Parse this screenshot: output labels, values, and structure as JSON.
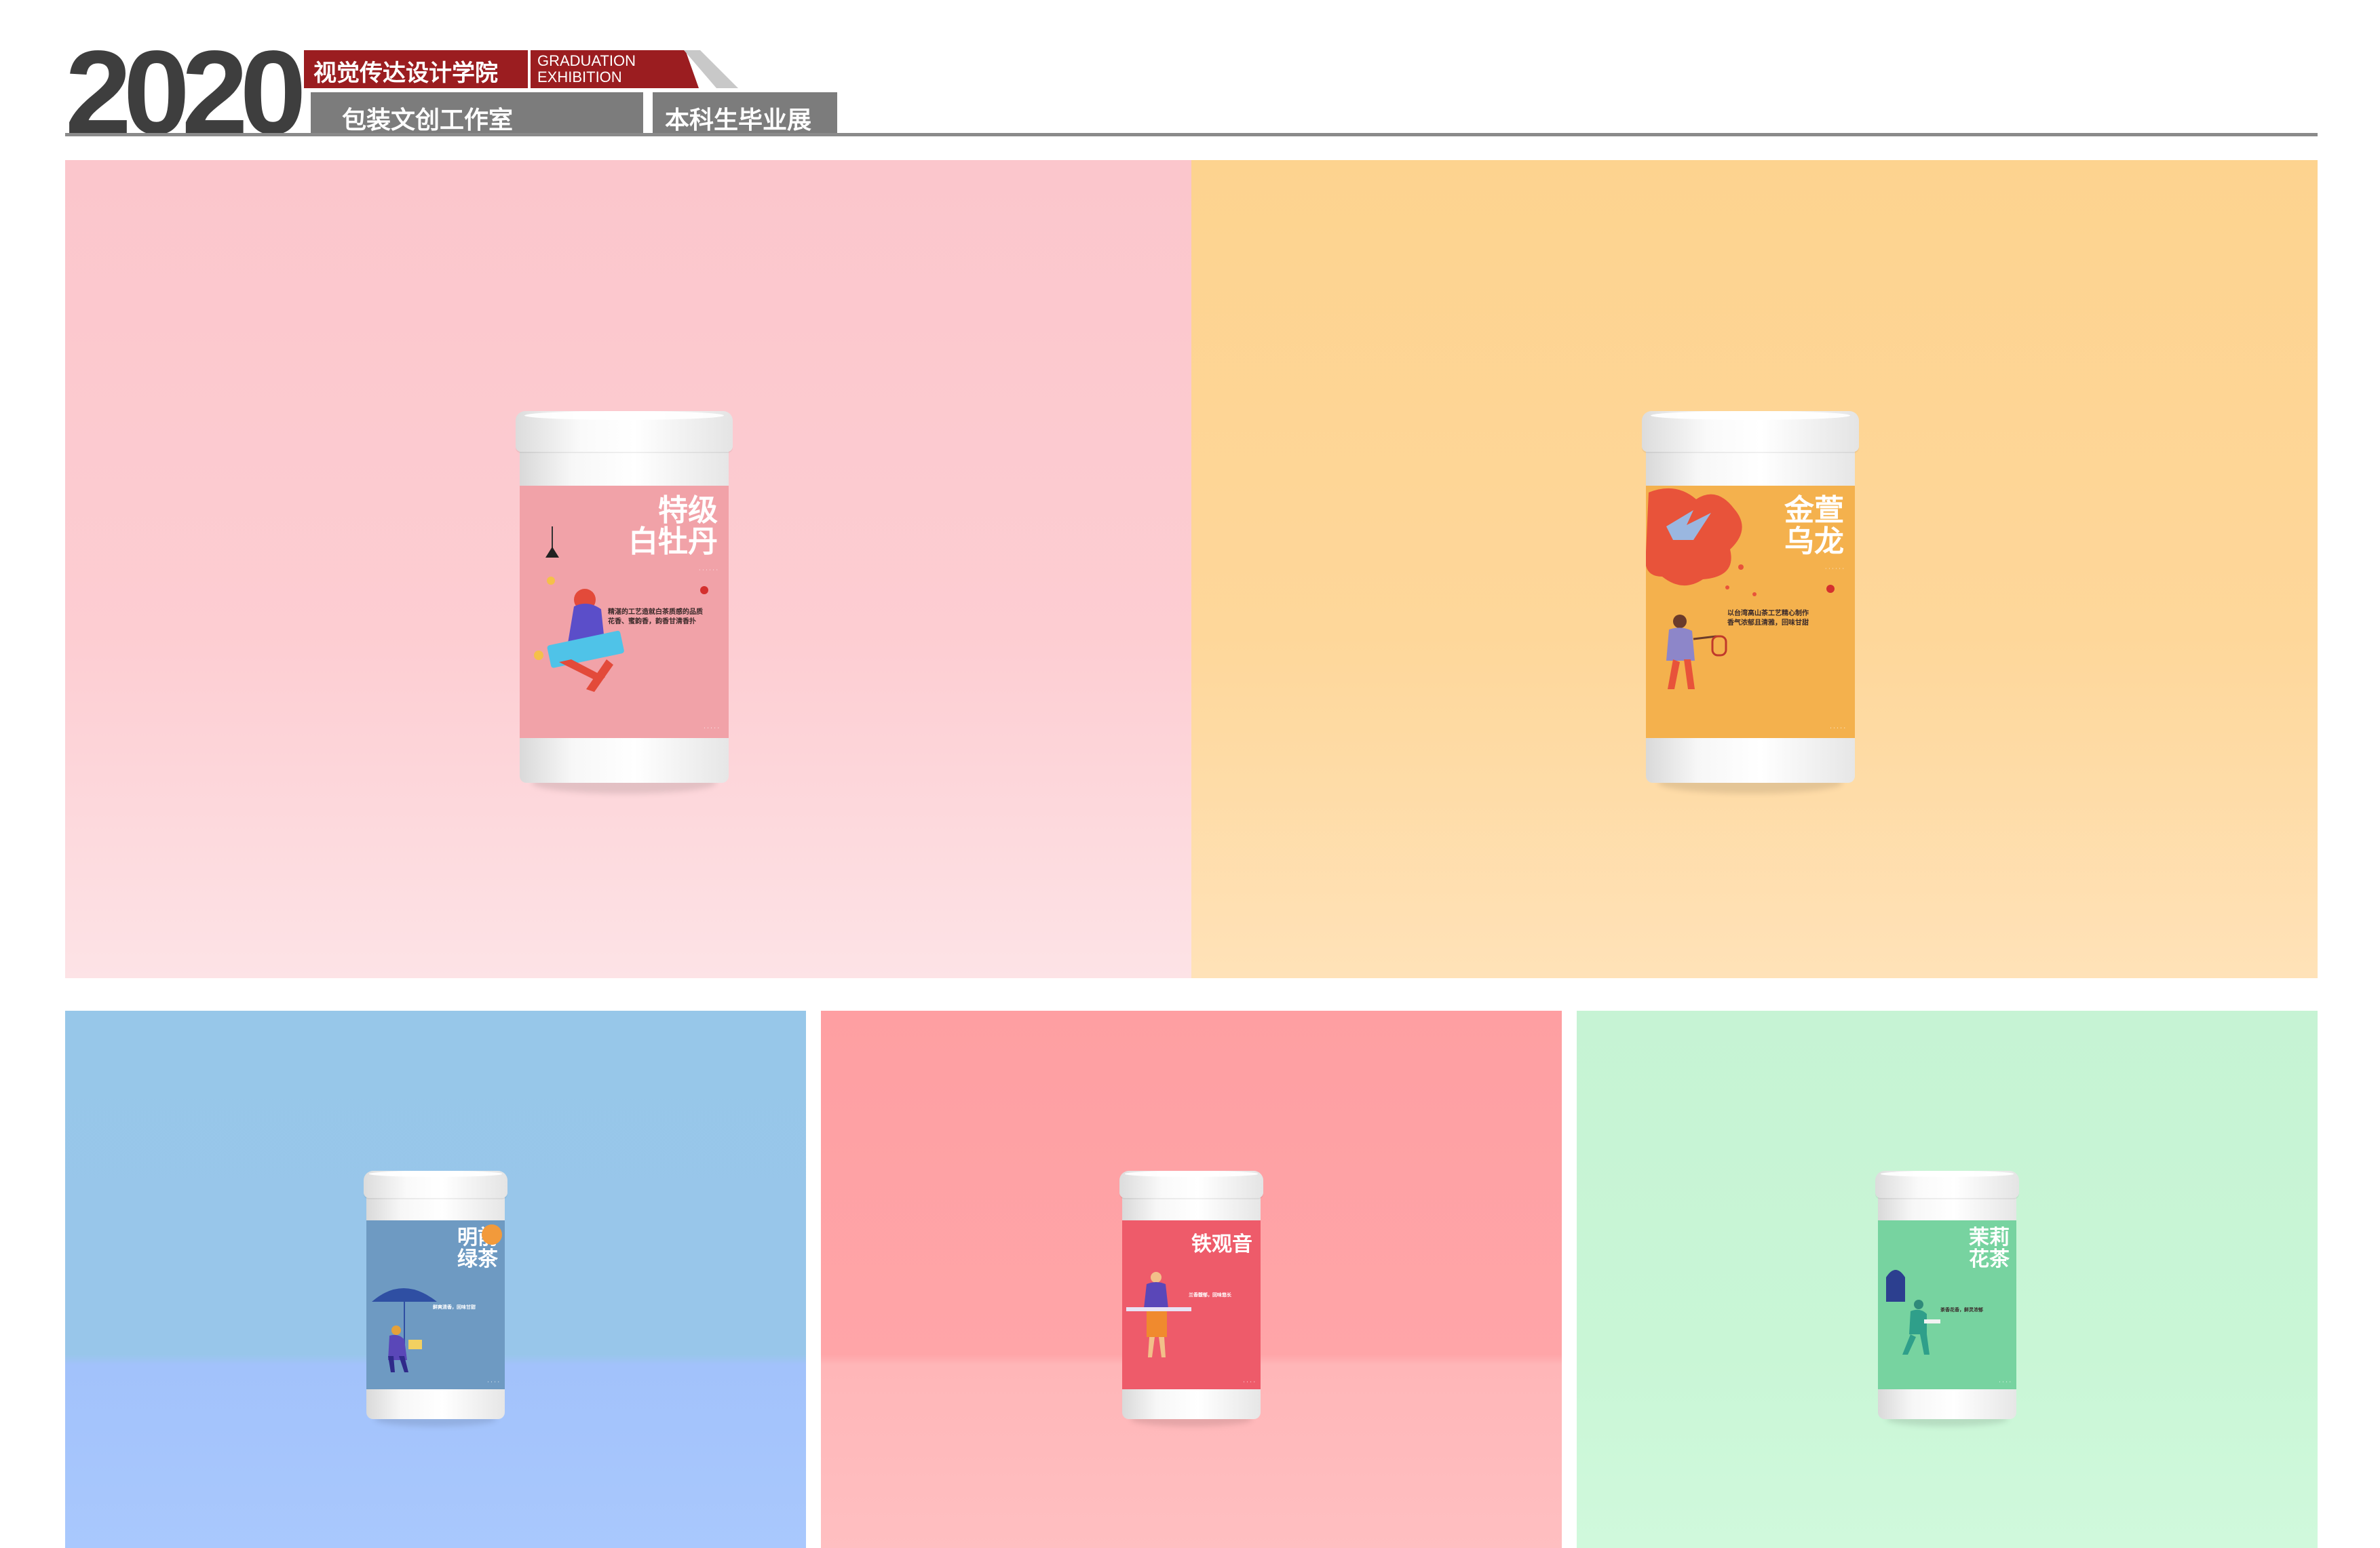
{
  "header": {
    "year": "2020",
    "school": "视觉传达设计学院",
    "graduation_line1": "GRADUATION",
    "graduation_line2": "EXHIBITION",
    "studio": "包装文创工作室",
    "show": "本科生毕业展"
  },
  "colors": {
    "header_red": "#9b1d20",
    "header_grey": "#7c7c7c",
    "year_dark": "#3e3e3e"
  },
  "products": [
    {
      "name": "特级白牡丹",
      "title_lines": [
        "特级",
        "白牡丹"
      ],
      "background": "#fdcdd2",
      "label_color": "#f1a2a8",
      "desc_lines": [
        "精湛的工艺造就白茶质感的品质",
        "花香、蜜韵香，韵香甘清香扑"
      ]
    },
    {
      "name": "金萱乌龙",
      "title_lines": [
        "金萱",
        "乌龙"
      ],
      "background": "#fed79a",
      "label_color": "#f4b14d",
      "desc_lines": [
        "以台湾高山茶工艺精心制作",
        "香气浓郁且清雅，回味甘甜"
      ]
    },
    {
      "name": "明前绿茶",
      "title_lines": [
        "明前",
        "绿茶"
      ],
      "background": "#98c6ea",
      "label_color": "#6e9ac2",
      "desc_lines": [
        "鲜爽清香，回味甘甜"
      ]
    },
    {
      "name": "铁观音",
      "title_lines": [
        "铁观音"
      ],
      "background": "#ffa5a8",
      "label_color": "#ee5b6a",
      "desc_lines": [
        "兰香馥郁，回味悠长"
      ]
    },
    {
      "name": "茉莉花茶",
      "title_lines": [
        "茉莉",
        "花茶"
      ],
      "background": "#c9f6d6",
      "label_color": "#77d3a0",
      "desc_lines": [
        "茶香花香，鲜灵浓郁"
      ]
    }
  ]
}
